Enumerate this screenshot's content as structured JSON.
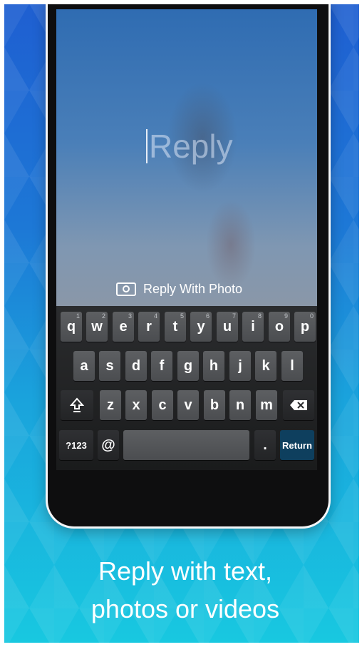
{
  "compose": {
    "placeholder": "Reply",
    "photo_button_label": "Reply With Photo"
  },
  "keyboard": {
    "row1": [
      {
        "key": "q",
        "hint": "1"
      },
      {
        "key": "w",
        "hint": "2"
      },
      {
        "key": "e",
        "hint": "3"
      },
      {
        "key": "r",
        "hint": "4"
      },
      {
        "key": "t",
        "hint": "5"
      },
      {
        "key": "y",
        "hint": "6"
      },
      {
        "key": "u",
        "hint": "7"
      },
      {
        "key": "i",
        "hint": "8"
      },
      {
        "key": "o",
        "hint": "9"
      },
      {
        "key": "p",
        "hint": "0"
      }
    ],
    "row2": [
      "a",
      "s",
      "d",
      "f",
      "g",
      "h",
      "j",
      "k",
      "l"
    ],
    "row3": [
      "z",
      "x",
      "c",
      "v",
      "b",
      "n",
      "m"
    ],
    "symbols_label": "?123",
    "at_label": "@",
    "period_label": ".",
    "return_label": "Return"
  },
  "tagline": {
    "line1": "Reply with text,",
    "line2": "photos or videos"
  },
  "colors": {
    "background_top": "#1f5fd1",
    "background_bottom": "#18c8e0",
    "return_key": "#0e3f5e"
  }
}
